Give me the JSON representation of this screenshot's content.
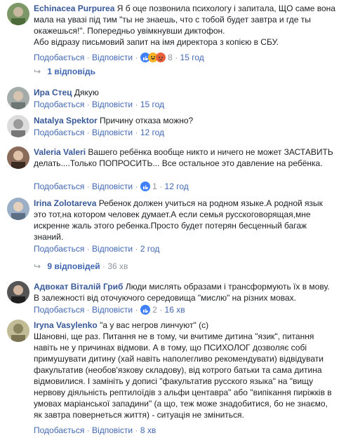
{
  "comments": [
    {
      "author": "Echinacea Purpurea",
      "text": "Я б оце позвонила психологу і запитала, ЩО саме вона мала на увазі під тим \"ты не знаешь, что с тобой будет завтра и где ты окажешься!\". Попередньо увімкнувши диктофон.",
      "text2": "Або відразу письмовий запит на імя директора з копією в СБУ.",
      "like": "Подобається",
      "reply": "Відповісти",
      "reactions_count": "8",
      "time": "15 год",
      "avatar_color": "#6f8f5a",
      "replies_link": "1 відповідь"
    },
    {
      "author": "Ира Стец",
      "text": "Дякую",
      "like": "Подобається",
      "reply": "Відповісти",
      "time": "15 год",
      "avatar_color": "#9aa4a0"
    },
    {
      "author": "Natalya Spektor",
      "text": "Причину отказа можно?",
      "like": "Подобається",
      "reply": "Відповісти",
      "time": "12 год",
      "avatar_color": "#d9d9d9"
    },
    {
      "author": "Valeria Valeri",
      "text": "Вашего ребёнка вообще никто и ничего не может ЗАСТАВИТЬ делать....Только ПОПРОСИТЬ... Все остальное это давление на ребёнка.",
      "like": "Подобається",
      "reply": "Відповісти",
      "reactions_count": "1",
      "time": "12 год",
      "avatar_color": "#7a5a4a"
    },
    {
      "author": "Irina Zolotareva",
      "text": "Ребенок должен учиться на родном языке.А родной язык это тот,на котором человек думает.А если семья русскоговорящая,мне искренне жаль этого ребенка.Просто будет потерян бесценный багаж знаний.",
      "like": "Подобається",
      "reply": "Відповісти",
      "time": "2 год",
      "avatar_color": "#8aa0b8",
      "replies_link": "9 відповідей",
      "replies_meta": "36 хв"
    },
    {
      "author": "Адвокат Віталій Гриб",
      "text": "Люди мислять образами і трансформують їх в мову. В залежності від оточуючого середовища \"мислю\" на різних мовах.",
      "like": "Подобається",
      "reply": "Відповісти",
      "reactions_count": "2",
      "time": "16 хв",
      "avatar_color": "#3b3b3b"
    },
    {
      "author": "Iryna Vasylenko",
      "text": "\"а у вас негров линчуют\" (с)",
      "text2": "Шановні, ще раз. Питання не в тому, чи вчитиме дитина \"язик\", питання навіть не у причинах відмови. А в тому, що ПСИХОЛОГ дозволяє собі примушувати дитину (хай навіть наполегливо рекомендувати) відвідувати факультатив (необов'язкову складову), від котрого батьки та сама дитина відмовилися. І замініть у дописі \"факультатив русского языка\" на \"вищу нервову діяльність рептилоїдів з альфи центавра\" або \"випікання пиріжків в умовах маріанської западини\" (а що, теж може знадобитися, бо не знаємо, як завтра повернеться життя) - ситуація не зміниться.",
      "like": "Подобається",
      "reply": "Відповісти",
      "time": "8 хв",
      "avatar_color": "#b5b08a"
    }
  ]
}
